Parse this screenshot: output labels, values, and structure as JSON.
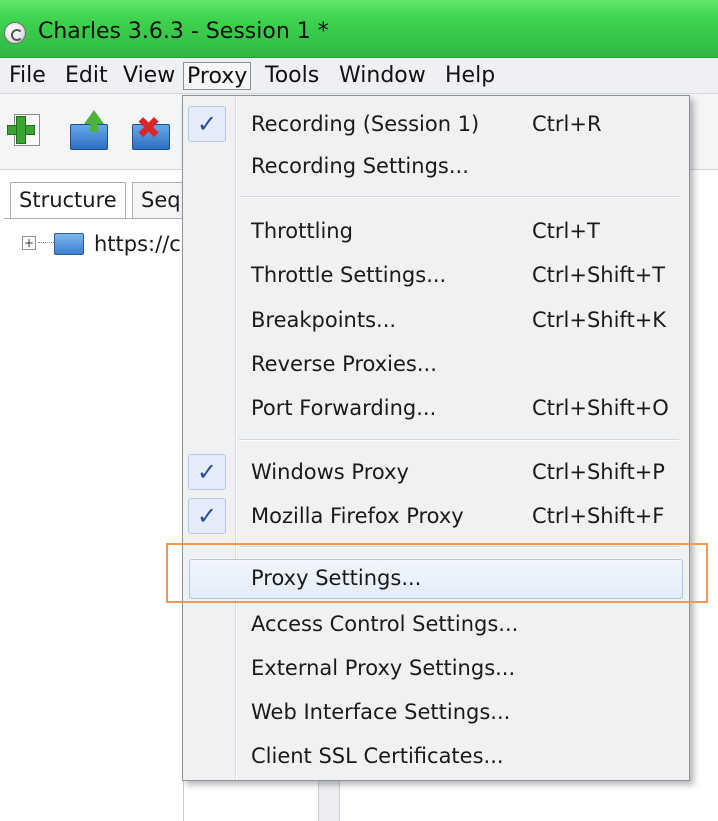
{
  "window": {
    "title": "Charles 3.6.3 - Session 1 *"
  },
  "menubar": {
    "items": [
      {
        "label": "File"
      },
      {
        "label": "Edit"
      },
      {
        "label": "View"
      },
      {
        "label": "Proxy"
      },
      {
        "label": "Tools"
      },
      {
        "label": "Window"
      },
      {
        "label": "Help"
      }
    ]
  },
  "toolbar": {
    "buttons": [
      {
        "icon": "new-session-icon"
      },
      {
        "icon": "open-session-icon"
      },
      {
        "icon": "close-session-icon"
      }
    ]
  },
  "left_panel": {
    "tabs": [
      {
        "label": "Structure"
      },
      {
        "label": "Seq"
      }
    ],
    "tree": [
      {
        "label": "https://c"
      }
    ]
  },
  "proxy_menu": {
    "check_mark": "✓",
    "items": [
      {
        "label": "Recording (Session 1)",
        "shortcut": "Ctrl+R",
        "checked": true
      },
      {
        "label": "Recording Settings...",
        "shortcut": ""
      },
      {
        "label": "Throttling",
        "shortcut": "Ctrl+T"
      },
      {
        "label": "Throttle Settings...",
        "shortcut": "Ctrl+Shift+T"
      },
      {
        "label": "Breakpoints...",
        "shortcut": "Ctrl+Shift+K"
      },
      {
        "label": "Reverse Proxies...",
        "shortcut": ""
      },
      {
        "label": "Port Forwarding...",
        "shortcut": "Ctrl+Shift+O"
      },
      {
        "label": "Windows Proxy",
        "shortcut": "Ctrl+Shift+P",
        "checked": true
      },
      {
        "label": "Mozilla Firefox Proxy",
        "shortcut": "Ctrl+Shift+F",
        "checked": true
      },
      {
        "label": "Proxy Settings...",
        "shortcut": "",
        "highlighted": true
      },
      {
        "label": "Access Control Settings...",
        "shortcut": ""
      },
      {
        "label": "External Proxy Settings...",
        "shortcut": ""
      },
      {
        "label": "Web Interface Settings...",
        "shortcut": ""
      },
      {
        "label": "Client SSL Certificates...",
        "shortcut": ""
      }
    ]
  },
  "colors": {
    "title_bar": "#3ed24e",
    "highlight_frame": "#f29a4a",
    "hover_item": "#e3ecf8"
  }
}
